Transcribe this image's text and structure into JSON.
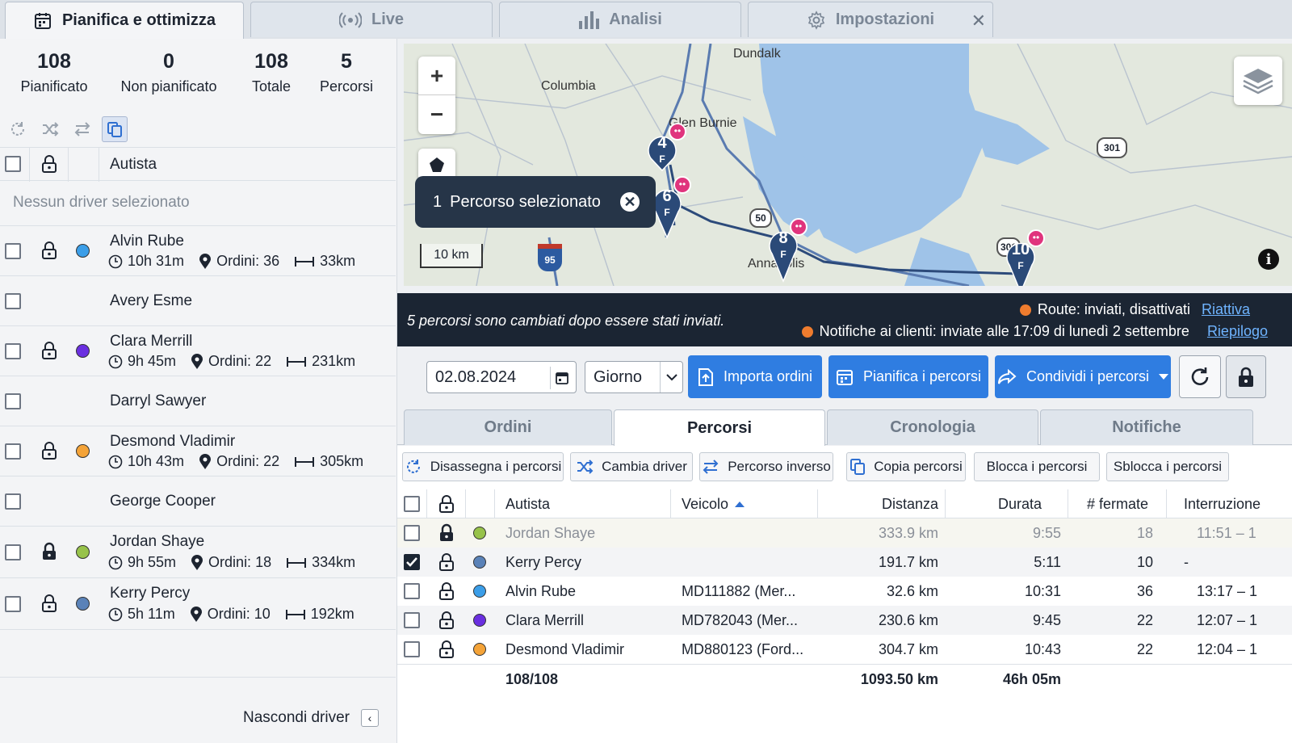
{
  "tabs": [
    {
      "label": "Pianifica e ottimizza",
      "icon": "calendar-icon"
    },
    {
      "label": "Live",
      "icon": "broadcast-icon"
    },
    {
      "label": "Analisi",
      "icon": "bar-chart-icon"
    },
    {
      "label": "Impostazioni",
      "icon": "gear-icon"
    }
  ],
  "stats": [
    {
      "value": "108",
      "label": "Pianificato"
    },
    {
      "value": "0",
      "label": "Non pianificato"
    },
    {
      "value": "108",
      "label": "Totale"
    },
    {
      "value": "5",
      "label": "Percorsi"
    }
  ],
  "driver_list": {
    "header_label": "Autista",
    "empty_text": "Nessun driver selezionato",
    "drivers": [
      {
        "name": "Alvin Rube",
        "time": "10h 31m",
        "orders": "Ordini: 36",
        "distance": "33km",
        "color": "#3b9ee8",
        "locked": false
      },
      {
        "name": "Avery Esme"
      },
      {
        "name": "Clara Merrill",
        "time": "9h 45m",
        "orders": "Ordini: 22",
        "distance": "231km",
        "color": "#6a2fe0",
        "locked": false
      },
      {
        "name": "Darryl Sawyer"
      },
      {
        "name": "Desmond Vladimir",
        "time": "10h 43m",
        "orders": "Ordini: 22",
        "distance": "305km",
        "color": "#f4a338",
        "locked": false
      },
      {
        "name": "George Cooper"
      },
      {
        "name": "Jordan Shaye",
        "time": "9h 55m",
        "orders": "Ordini: 18",
        "distance": "334km",
        "color": "#97c24a",
        "locked": true
      },
      {
        "name": "Kerry Percy",
        "time": "5h 11m",
        "orders": "Ordini: 10",
        "distance": "192km",
        "color": "#5a82b8",
        "locked": false
      }
    ],
    "hide_label": "Nascondi driver"
  },
  "map": {
    "zoom_in": "+",
    "zoom_out": "−",
    "selection_count": "1",
    "selection_label": "Percorso selezionato",
    "scale_label": "10 km",
    "places": [
      "Dundalk",
      "Columbia",
      "Glen Burnie",
      "Annapolis"
    ],
    "road_shields": [
      "301",
      "95",
      "50",
      "301"
    ],
    "pins": [
      {
        "number": "4",
        "sub": "F"
      },
      {
        "number": "6",
        "sub": "F"
      },
      {
        "number": "8",
        "sub": "F"
      },
      {
        "number": "10",
        "sub": "F"
      }
    ],
    "info": "i"
  },
  "banner": {
    "message": "5 percorsi sono cambiati dopo essere stati inviati.",
    "route_status": "Route: inviati, disattivati",
    "route_link": "Riattiva",
    "notify_status": "Notifiche ai clienti: inviate alle 17:09 di lunedì 2 settembre",
    "notify_link": "Riepilogo"
  },
  "controls": {
    "date": "02.08.2024",
    "period": "Giorno",
    "import_label": "Importa ordini",
    "plan_label": "Pianifica i percorsi",
    "share_label": "Condividi i percorsi"
  },
  "sub_tabs": [
    "Ordini",
    "Percorsi",
    "Cronologia",
    "Notifiche"
  ],
  "actions": [
    "Disassegna i percorsi",
    "Cambia driver",
    "Percorso inverso",
    "Copia percorsi",
    "Blocca i percorsi",
    "Sblocca i percorsi"
  ],
  "table": {
    "headers": {
      "driver": "Autista",
      "vehicle": "Veicolo",
      "distance": "Distanza",
      "duration": "Durata",
      "stops": "# fermate",
      "break": "Interruzione"
    },
    "rows": [
      {
        "driver": "Jordan Shaye",
        "vehicle": "",
        "distance": "333.9 km",
        "duration": "9:55",
        "stops": "18",
        "break": "11:51 – 1",
        "color": "#97c24a",
        "locked": true,
        "checked": false
      },
      {
        "driver": "Kerry Percy",
        "vehicle": "",
        "distance": "191.7 km",
        "duration": "5:11",
        "stops": "10",
        "break": "-",
        "color": "#5a82b8",
        "locked": false,
        "checked": true
      },
      {
        "driver": "Alvin Rube",
        "vehicle": "MD111882 (Mer...",
        "distance": "32.6 km",
        "duration": "10:31",
        "stops": "36",
        "break": "13:17 – 1",
        "color": "#3b9ee8",
        "locked": false,
        "checked": false
      },
      {
        "driver": "Clara Merrill",
        "vehicle": "MD782043 (Mer...",
        "distance": "230.6 km",
        "duration": "9:45",
        "stops": "22",
        "break": "12:07 – 1",
        "color": "#6a2fe0",
        "locked": false,
        "checked": false
      },
      {
        "driver": "Desmond Vladimir",
        "vehicle": "MD880123 (Ford...",
        "distance": "304.7 km",
        "duration": "10:43",
        "stops": "22",
        "break": "12:04 – 1",
        "color": "#f4a338",
        "locked": false,
        "checked": false
      }
    ],
    "totals": {
      "count": "108/108",
      "distance": "1093.50 km",
      "duration": "46h 05m"
    }
  }
}
